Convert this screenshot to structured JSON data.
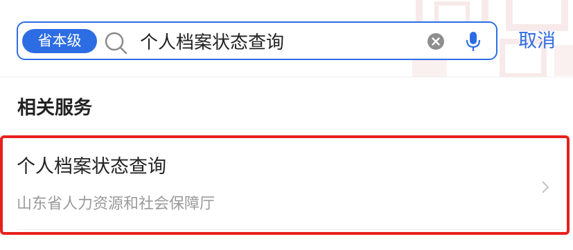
{
  "search": {
    "scope_label": "省本级",
    "query": "个人档案状态查询",
    "cancel_label": "取消"
  },
  "section": {
    "title": "相关服务"
  },
  "results": [
    {
      "title": "个人档案状态查询",
      "subtitle": "山东省人力资源和社会保障厅"
    }
  ],
  "icons": {
    "search": "search-icon",
    "clear": "clear-icon",
    "mic": "microphone-icon",
    "chevron": "chevron-right-icon"
  },
  "colors": {
    "accent": "#2d6de3",
    "highlight_border": "#e8201c",
    "watermark": "#f2d6d6"
  }
}
